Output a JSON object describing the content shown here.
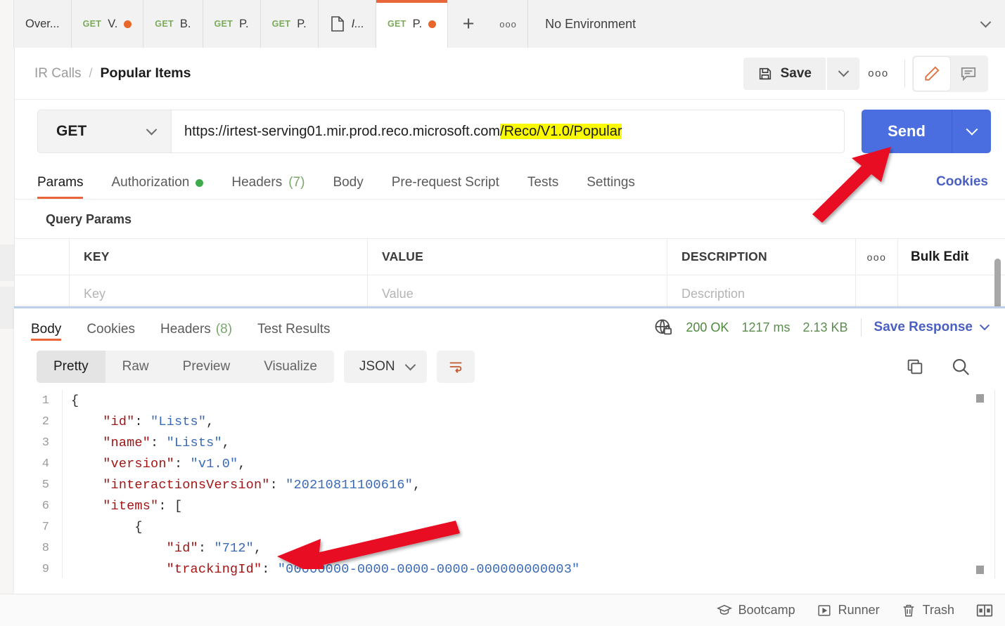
{
  "tabbar": {
    "tabs": [
      {
        "label": "Over...",
        "method": "",
        "unsaved": false,
        "icon": "",
        "active": false
      },
      {
        "label": "V.",
        "method": "GET",
        "unsaved": true,
        "icon": "",
        "active": false
      },
      {
        "label": "B.",
        "method": "GET",
        "unsaved": false,
        "icon": "",
        "active": false
      },
      {
        "label": "P.",
        "method": "GET",
        "unsaved": false,
        "icon": "",
        "active": false
      },
      {
        "label": "P.",
        "method": "GET",
        "unsaved": false,
        "icon": "",
        "active": false
      },
      {
        "label": "I...",
        "method": "",
        "unsaved": false,
        "icon": "doc-icon",
        "active": false
      },
      {
        "label": "P.",
        "method": "GET",
        "unsaved": true,
        "icon": "",
        "active": true
      }
    ],
    "new_tab_label": "+",
    "more_label": "ooo",
    "environment": "No Environment"
  },
  "header": {
    "breadcrumb_collection": "IR Calls",
    "breadcrumb_sep": "/",
    "breadcrumb_request": "Popular Items",
    "save_label": "Save",
    "more_label": "ooo",
    "edit_icon": "pencil-icon",
    "comment_icon": "comment-icon"
  },
  "request": {
    "method": "GET",
    "url_plain": "https://irtest-serving01.mir.prod.reco.microsoft.com",
    "url_highlighted": "/Reco/V1.0/Popular",
    "send_label": "Send"
  },
  "request_tabs": {
    "items": [
      {
        "label": "Params",
        "badge": "",
        "dot": false,
        "active": true
      },
      {
        "label": "Authorization",
        "badge": "",
        "dot": true,
        "active": false
      },
      {
        "label": "Headers",
        "badge": "(7)",
        "dot": false,
        "active": false
      },
      {
        "label": "Body",
        "badge": "",
        "dot": false,
        "active": false
      },
      {
        "label": "Pre-request Script",
        "badge": "",
        "dot": false,
        "active": false
      },
      {
        "label": "Tests",
        "badge": "",
        "dot": false,
        "active": false
      },
      {
        "label": "Settings",
        "badge": "",
        "dot": false,
        "active": false
      }
    ],
    "cookies_label": "Cookies"
  },
  "query_params": {
    "title": "Query Params",
    "columns": [
      "KEY",
      "VALUE",
      "DESCRIPTION"
    ],
    "more_label": "ooo",
    "bulk_edit_label": "Bulk Edit",
    "placeholder_row": [
      "Key",
      "Value",
      "Description"
    ]
  },
  "response": {
    "tabs": [
      {
        "label": "Body",
        "badge": "",
        "active": true
      },
      {
        "label": "Cookies",
        "badge": "",
        "active": false
      },
      {
        "label": "Headers",
        "badge": "(8)",
        "active": false
      },
      {
        "label": "Test Results",
        "badge": "",
        "active": false
      }
    ],
    "globe_icon": "globe-lock-icon",
    "status": "200 OK",
    "time": "1217 ms",
    "size": "2.13 KB",
    "save_response_label": "Save Response",
    "view_modes": [
      "Pretty",
      "Raw",
      "Preview",
      "Visualize"
    ],
    "active_view_mode": "Pretty",
    "format": "JSON",
    "wrap_icon": "wrap-lines-icon",
    "copy_icon": "copy-icon",
    "search_icon": "search-icon",
    "code_lines": [
      {
        "n": "1",
        "indent": 0,
        "segs": [
          {
            "t": "{",
            "c": "p"
          }
        ]
      },
      {
        "n": "2",
        "indent": 1,
        "segs": [
          {
            "t": "\"id\"",
            "c": "k"
          },
          {
            "t": ": ",
            "c": "p"
          },
          {
            "t": "\"Lists\"",
            "c": "s"
          },
          {
            "t": ",",
            "c": "p"
          }
        ]
      },
      {
        "n": "3",
        "indent": 1,
        "segs": [
          {
            "t": "\"name\"",
            "c": "k"
          },
          {
            "t": ": ",
            "c": "p"
          },
          {
            "t": "\"Lists\"",
            "c": "s"
          },
          {
            "t": ",",
            "c": "p"
          }
        ]
      },
      {
        "n": "4",
        "indent": 1,
        "segs": [
          {
            "t": "\"version\"",
            "c": "k"
          },
          {
            "t": ": ",
            "c": "p"
          },
          {
            "t": "\"v1.0\"",
            "c": "s"
          },
          {
            "t": ",",
            "c": "p"
          }
        ]
      },
      {
        "n": "5",
        "indent": 1,
        "segs": [
          {
            "t": "\"interactionsVersion\"",
            "c": "k"
          },
          {
            "t": ": ",
            "c": "p"
          },
          {
            "t": "\"20210811100616\"",
            "c": "s"
          },
          {
            "t": ",",
            "c": "p"
          }
        ]
      },
      {
        "n": "6",
        "indent": 1,
        "segs": [
          {
            "t": "\"items\"",
            "c": "k"
          },
          {
            "t": ": [",
            "c": "p"
          }
        ]
      },
      {
        "n": "7",
        "indent": 2,
        "segs": [
          {
            "t": "{",
            "c": "p"
          }
        ]
      },
      {
        "n": "8",
        "indent": 3,
        "segs": [
          {
            "t": "\"id\"",
            "c": "k"
          },
          {
            "t": ": ",
            "c": "p"
          },
          {
            "t": "\"712\"",
            "c": "s"
          },
          {
            "t": ",",
            "c": "p"
          }
        ]
      },
      {
        "n": "9",
        "indent": 3,
        "segs": [
          {
            "t": "\"trackingId\"",
            "c": "k"
          },
          {
            "t": ": ",
            "c": "p"
          },
          {
            "t": "\"00000000-0000-0000-0000-000000000003\"",
            "c": "s"
          }
        ]
      }
    ]
  },
  "statusbar": {
    "items": [
      {
        "label": "Bootcamp",
        "icon": "graduation-cap-icon"
      },
      {
        "label": "Runner",
        "icon": "play-box-icon"
      },
      {
        "label": "Trash",
        "icon": "trash-icon"
      }
    ],
    "layout_icon": "two-pane-layout-icon"
  },
  "annotations": {
    "arrow_send": "red-arrow-pointing-to-send-button",
    "arrow_id": "red-arrow-pointing-to-id-field"
  }
}
